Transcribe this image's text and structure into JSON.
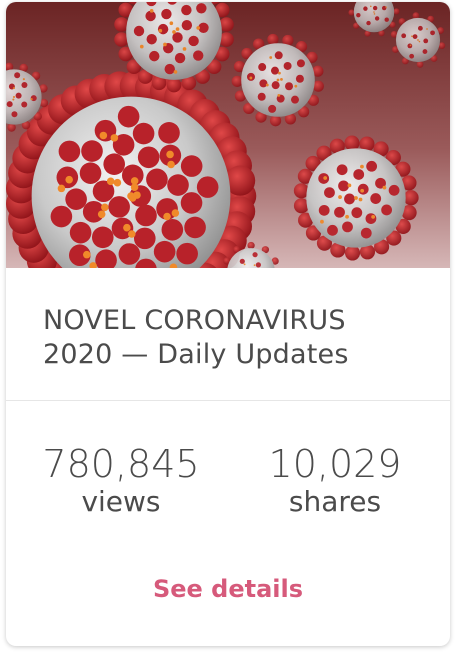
{
  "card": {
    "image_subject": "coronavirus-illustration",
    "title": "NOVEL CORONAVIRUS 2020 — Daily Updates",
    "stats": {
      "views_value": "780,845",
      "views_label": "views",
      "shares_value": "10,029",
      "shares_label": "shares"
    },
    "link_label": "See details"
  },
  "colors": {
    "background_gradient_top": "#6b2424",
    "background_gradient_bottom": "#c9a3a3",
    "virus_body": "#cfcfcf",
    "spike": "#c0282f",
    "title_text": "#4b4b4b",
    "link": "#d65a7b"
  }
}
